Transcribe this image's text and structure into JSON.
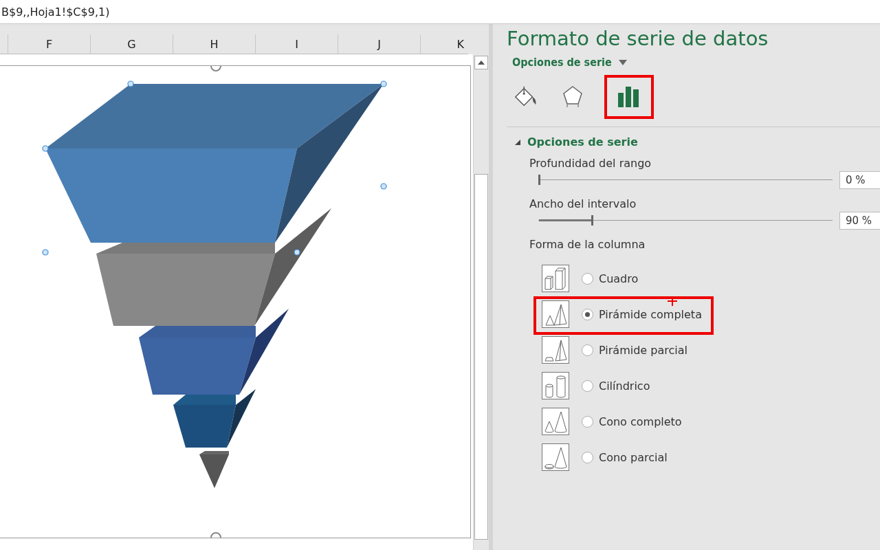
{
  "formula_bar": {
    "text": "B$9,,Hoja1!$C$9,1)"
  },
  "columns": [
    "",
    "F",
    "G",
    "H",
    "I",
    "J",
    "K"
  ],
  "pane": {
    "title": "Formato de serie de datos",
    "options_menu": "Opciones de serie",
    "tabs": [
      {
        "kind": "fill",
        "selected": false
      },
      {
        "kind": "effects",
        "selected": false
      },
      {
        "kind": "series",
        "selected": true
      }
    ],
    "section": {
      "title": "Opciones de serie",
      "expanded": true
    },
    "sliders": [
      {
        "label": "Profundidad del rango",
        "level": 0,
        "value": "0 %"
      },
      {
        "label": "Ancho del intervalo",
        "level": 0.18,
        "value": "90 %"
      }
    ],
    "shape_label": "Forma de la columna",
    "shapes": [
      {
        "kind": "box",
        "label": "Cuadro",
        "selected": false
      },
      {
        "kind": "pyramid",
        "label": "Pirámide completa",
        "selected": true
      },
      {
        "kind": "pyramid-partial",
        "label": "Pirámide parcial",
        "selected": false
      },
      {
        "kind": "cylinder",
        "label": "Cilíndrico",
        "selected": false
      },
      {
        "kind": "cone",
        "label": "Cono completo",
        "selected": false
      },
      {
        "kind": "cone-partial",
        "label": "Cono parcial",
        "selected": false
      }
    ]
  }
}
